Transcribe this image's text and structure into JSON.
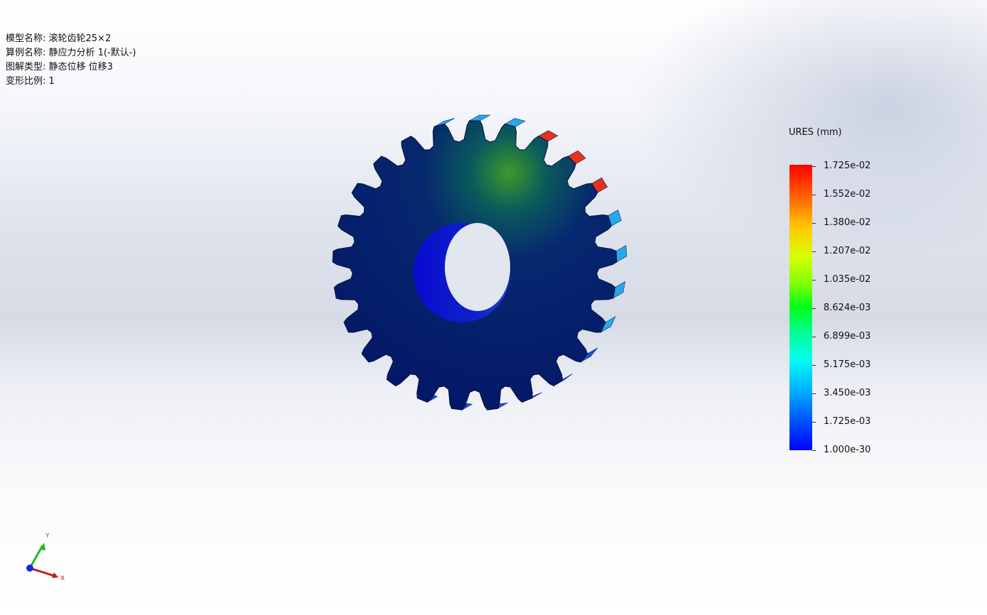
{
  "info": {
    "model_name": "模型名称: 滚轮齿轮25×2",
    "study_name": "算例名称: 静应力分析 1(-默认-)",
    "plot_type": "图解类型: 静态位移 位移3",
    "deform_scale": "变形比例: 1"
  },
  "legend": {
    "title": "URES (mm)",
    "labels": [
      "1.725e-02",
      "1.552e-02",
      "1.380e-02",
      "1.207e-02",
      "1.035e-02",
      "8.624e-03",
      "6.899e-03",
      "5.175e-03",
      "3.450e-03",
      "1.725e-03",
      "1.000e-30"
    ]
  },
  "triad": {
    "x_label": "X",
    "y_label": "Y"
  },
  "gear": {
    "tooth_count": 25,
    "colors": {
      "face": "#071a6e",
      "hub": "#0b0fc0",
      "tooth_blue": "#1a52d6",
      "tooth_light": "#27a8e8",
      "tooth_max": "#e8301a"
    }
  }
}
